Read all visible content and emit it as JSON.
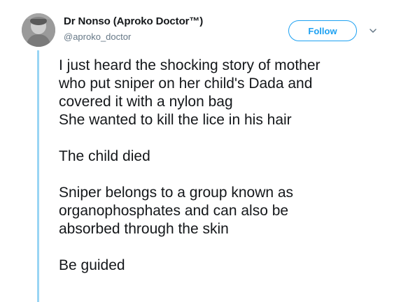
{
  "author": {
    "display_name": "Dr Nonso (Aproko Doctor™)",
    "handle": "@aproko_doctor",
    "avatar_icon": "profile-photo"
  },
  "actions": {
    "follow_label": "Follow",
    "more_icon": "chevron-down-icon"
  },
  "tweet": {
    "paragraphs": [
      {
        "lines": [
          "I just heard the shocking story of mother",
          "who put sniper on her child's Dada and",
          "covered it with a nylon bag",
          "She wanted to kill the lice in his hair"
        ]
      },
      {
        "lines": [
          "The child died"
        ]
      },
      {
        "lines": [
          "Sniper belongs to a group known as",
          "organophosphates and can also be",
          "absorbed through the skin"
        ]
      },
      {
        "lines": [
          "Be guided"
        ]
      }
    ]
  },
  "colors": {
    "accent": "#1da1f2",
    "thread_line": "#99d5f4",
    "handle_text": "#657786",
    "body_text": "#14171a"
  }
}
